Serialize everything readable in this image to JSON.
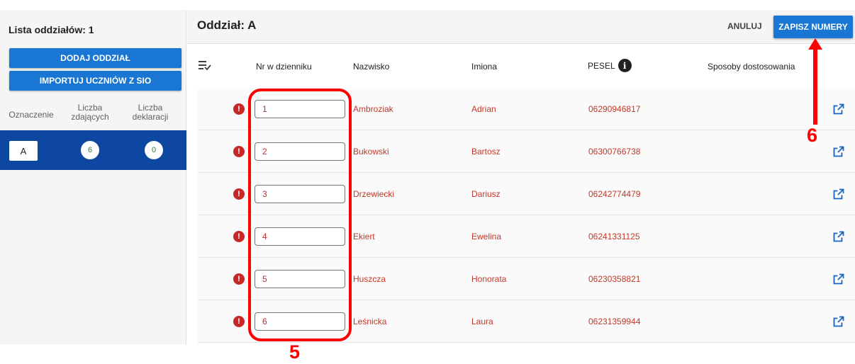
{
  "left_panel": {
    "title": "Lista oddziałów: 1",
    "add_button": "DODAJ ODDZIAŁ",
    "import_button": "IMPORTUJ UCZNIÓW Z SIO",
    "columns": {
      "oznaczenie": "Oznaczenie",
      "zdajacych": "Liczba\nzdających",
      "deklaracji": "Liczba\ndeklaracji"
    },
    "selected_class": {
      "label": "A",
      "zdajacych": "6",
      "deklaracji": "0"
    }
  },
  "main": {
    "title": "Oddział: A",
    "cancel_button": "ANULUJ",
    "save_button": "ZAPISZ NUMERY",
    "headers": {
      "nr": "Nr w dzienniku",
      "nazwisko": "Nazwisko",
      "imiona": "Imiona",
      "pesel": "PESEL",
      "sposoby": "Sposoby dostosowania"
    },
    "rows": [
      {
        "nr": "1",
        "nazwisko": "Ambroziak",
        "imiona": "Adrian",
        "pesel": "06290946817"
      },
      {
        "nr": "2",
        "nazwisko": "Bukowski",
        "imiona": "Bartosz",
        "pesel": "06300766738"
      },
      {
        "nr": "3",
        "nazwisko": "Drzewiecki",
        "imiona": "Dariusz",
        "pesel": "06242774479"
      },
      {
        "nr": "4",
        "nazwisko": "Ekiert",
        "imiona": "Ewelina",
        "pesel": "06241331125"
      },
      {
        "nr": "5",
        "nazwisko": "Huszcza",
        "imiona": "Honorata",
        "pesel": "06230358821"
      },
      {
        "nr": "6",
        "nazwisko": "Leśnicka",
        "imiona": "Laura",
        "pesel": "06231359944"
      }
    ]
  },
  "annotations": {
    "step_5": "5",
    "step_6": "6"
  },
  "colors": {
    "primary": "#1976d2",
    "selected_row": "#0d47a1",
    "error": "#c62828",
    "annotation": "#ff0000"
  },
  "icons": {
    "column_menu": "list-check-icon",
    "info": "info-icon",
    "error": "error-icon",
    "edit": "open-in-new-icon"
  }
}
